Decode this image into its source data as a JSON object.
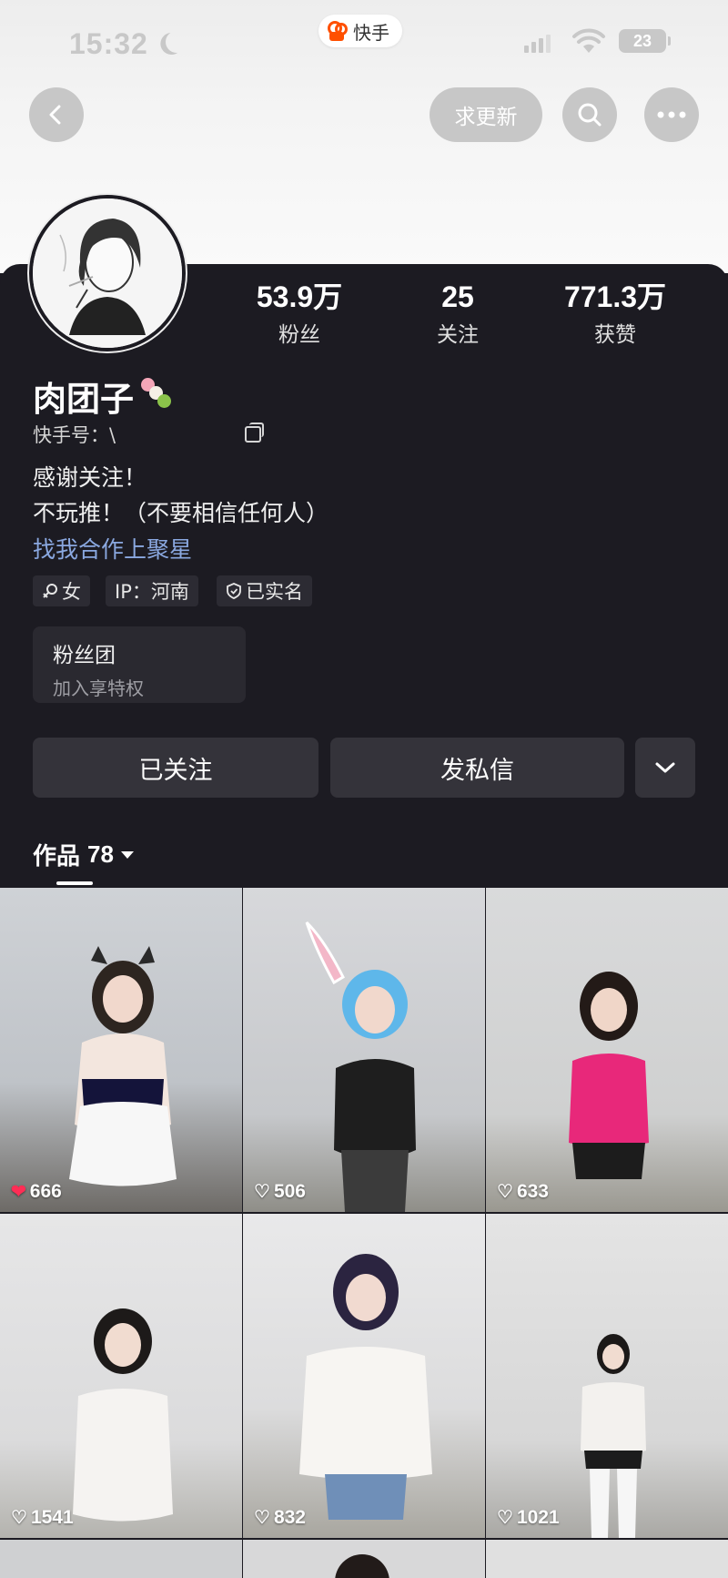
{
  "status_bar": {
    "time": "15:32",
    "app_name": "快手",
    "battery": "23"
  },
  "nav": {
    "request_update": "求更新"
  },
  "profile": {
    "stats": [
      {
        "value": "53.9万",
        "label": "粉丝"
      },
      {
        "value": "25",
        "label": "关注"
      },
      {
        "value": "771.3万",
        "label": "获赞"
      }
    ],
    "nickname": "肉团子",
    "user_id_label": "快手号：\\",
    "bio": [
      "感谢关注！",
      "不玩推！（不要相信任何人）"
    ],
    "bio_link": "找我合作上聚星",
    "tags": {
      "gender": "女",
      "ip": "IP：河南",
      "verified": "已实名"
    },
    "fan_club": {
      "title": "粉丝团",
      "subtitle": "加入享特权"
    },
    "actions": {
      "followed": "已关注",
      "message": "发私信"
    },
    "works_label": "作品",
    "works_count": "78"
  },
  "videos": [
    {
      "likes": "666",
      "liked": true
    },
    {
      "likes": "506",
      "liked": false
    },
    {
      "likes": "633",
      "liked": false
    },
    {
      "likes": "1541",
      "liked": false
    },
    {
      "likes": "832",
      "liked": false
    },
    {
      "likes": "1021",
      "liked": false
    }
  ],
  "colors": {
    "background": "#1c1b22",
    "link": "#8aa8e0",
    "heart_liked": "#ff2d55",
    "brand": "#ff5000"
  }
}
